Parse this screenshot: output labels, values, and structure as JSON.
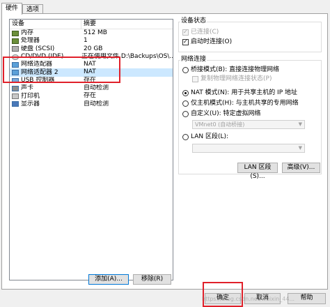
{
  "tabs": [
    {
      "label": "硬件",
      "active": true
    },
    {
      "label": "选项",
      "active": false
    }
  ],
  "device_list": {
    "headers": {
      "device": "设备",
      "summary": "摘要"
    },
    "rows": [
      {
        "icon": "memory-icon",
        "device": "内存",
        "summary": "512 MB"
      },
      {
        "icon": "processor-icon",
        "device": "处理器",
        "summary": "1"
      },
      {
        "icon": "hard-disk-icon",
        "device": "硬盘 (SCSI)",
        "summary": "20 GB"
      },
      {
        "icon": "cd-dvd-icon",
        "device": "CD/DVD (IDE)",
        "summary": "正在使用文件 D:\\Backups\\OS\\..."
      },
      {
        "icon": "network-adapter-icon",
        "device": "网络适配器",
        "summary": "NAT"
      },
      {
        "icon": "network-adapter-icon",
        "device": "网络适配器 2",
        "summary": "NAT",
        "selected": true
      },
      {
        "icon": "usb-controller-icon",
        "device": "USB 控制器",
        "summary": "存在"
      },
      {
        "icon": "sound-card-icon",
        "device": "声卡",
        "summary": "自动检测"
      },
      {
        "icon": "printer-icon",
        "device": "打印机",
        "summary": "存在"
      },
      {
        "icon": "display-icon",
        "device": "显示器",
        "summary": "自动检测"
      }
    ],
    "add_button": "添加(A)...",
    "remove_button": "移除(R)"
  },
  "device_status": {
    "title": "设备状态",
    "connected": {
      "label": "已连接(C)",
      "checked": true,
      "disabled": true
    },
    "connect_at_power_on": {
      "label": "启动时连接(O)",
      "checked": true,
      "disabled": false
    }
  },
  "network_connection": {
    "title": "网络连接",
    "bridged": {
      "label": "桥接模式(B): 直接连接物理网络",
      "selected": false
    },
    "replicate_state": {
      "label": "复制物理网络连接状态(P)",
      "checked": false,
      "disabled": true
    },
    "nat": {
      "label": "NAT 模式(N): 用于共享主机的 IP 地址",
      "selected": true
    },
    "host_only": {
      "label": "仅主机模式(H): 与主机共享的专用网络",
      "selected": false
    },
    "custom": {
      "label": "自定义(U): 特定虚拟网络",
      "selected": false
    },
    "custom_combo": "VMnet0 (自动桥接)",
    "lan_segment": {
      "label": "LAN 区段(L):",
      "selected": false
    },
    "lan_combo": "",
    "lan_segments_button": "LAN 区段(S)...",
    "advanced_button": "高级(V)..."
  },
  "footer": {
    "ok_button": "确定",
    "cancel_button": "取消",
    "help_button": "帮助"
  },
  "watermark": "https://blog.csdn.net/weixin_44..."
}
